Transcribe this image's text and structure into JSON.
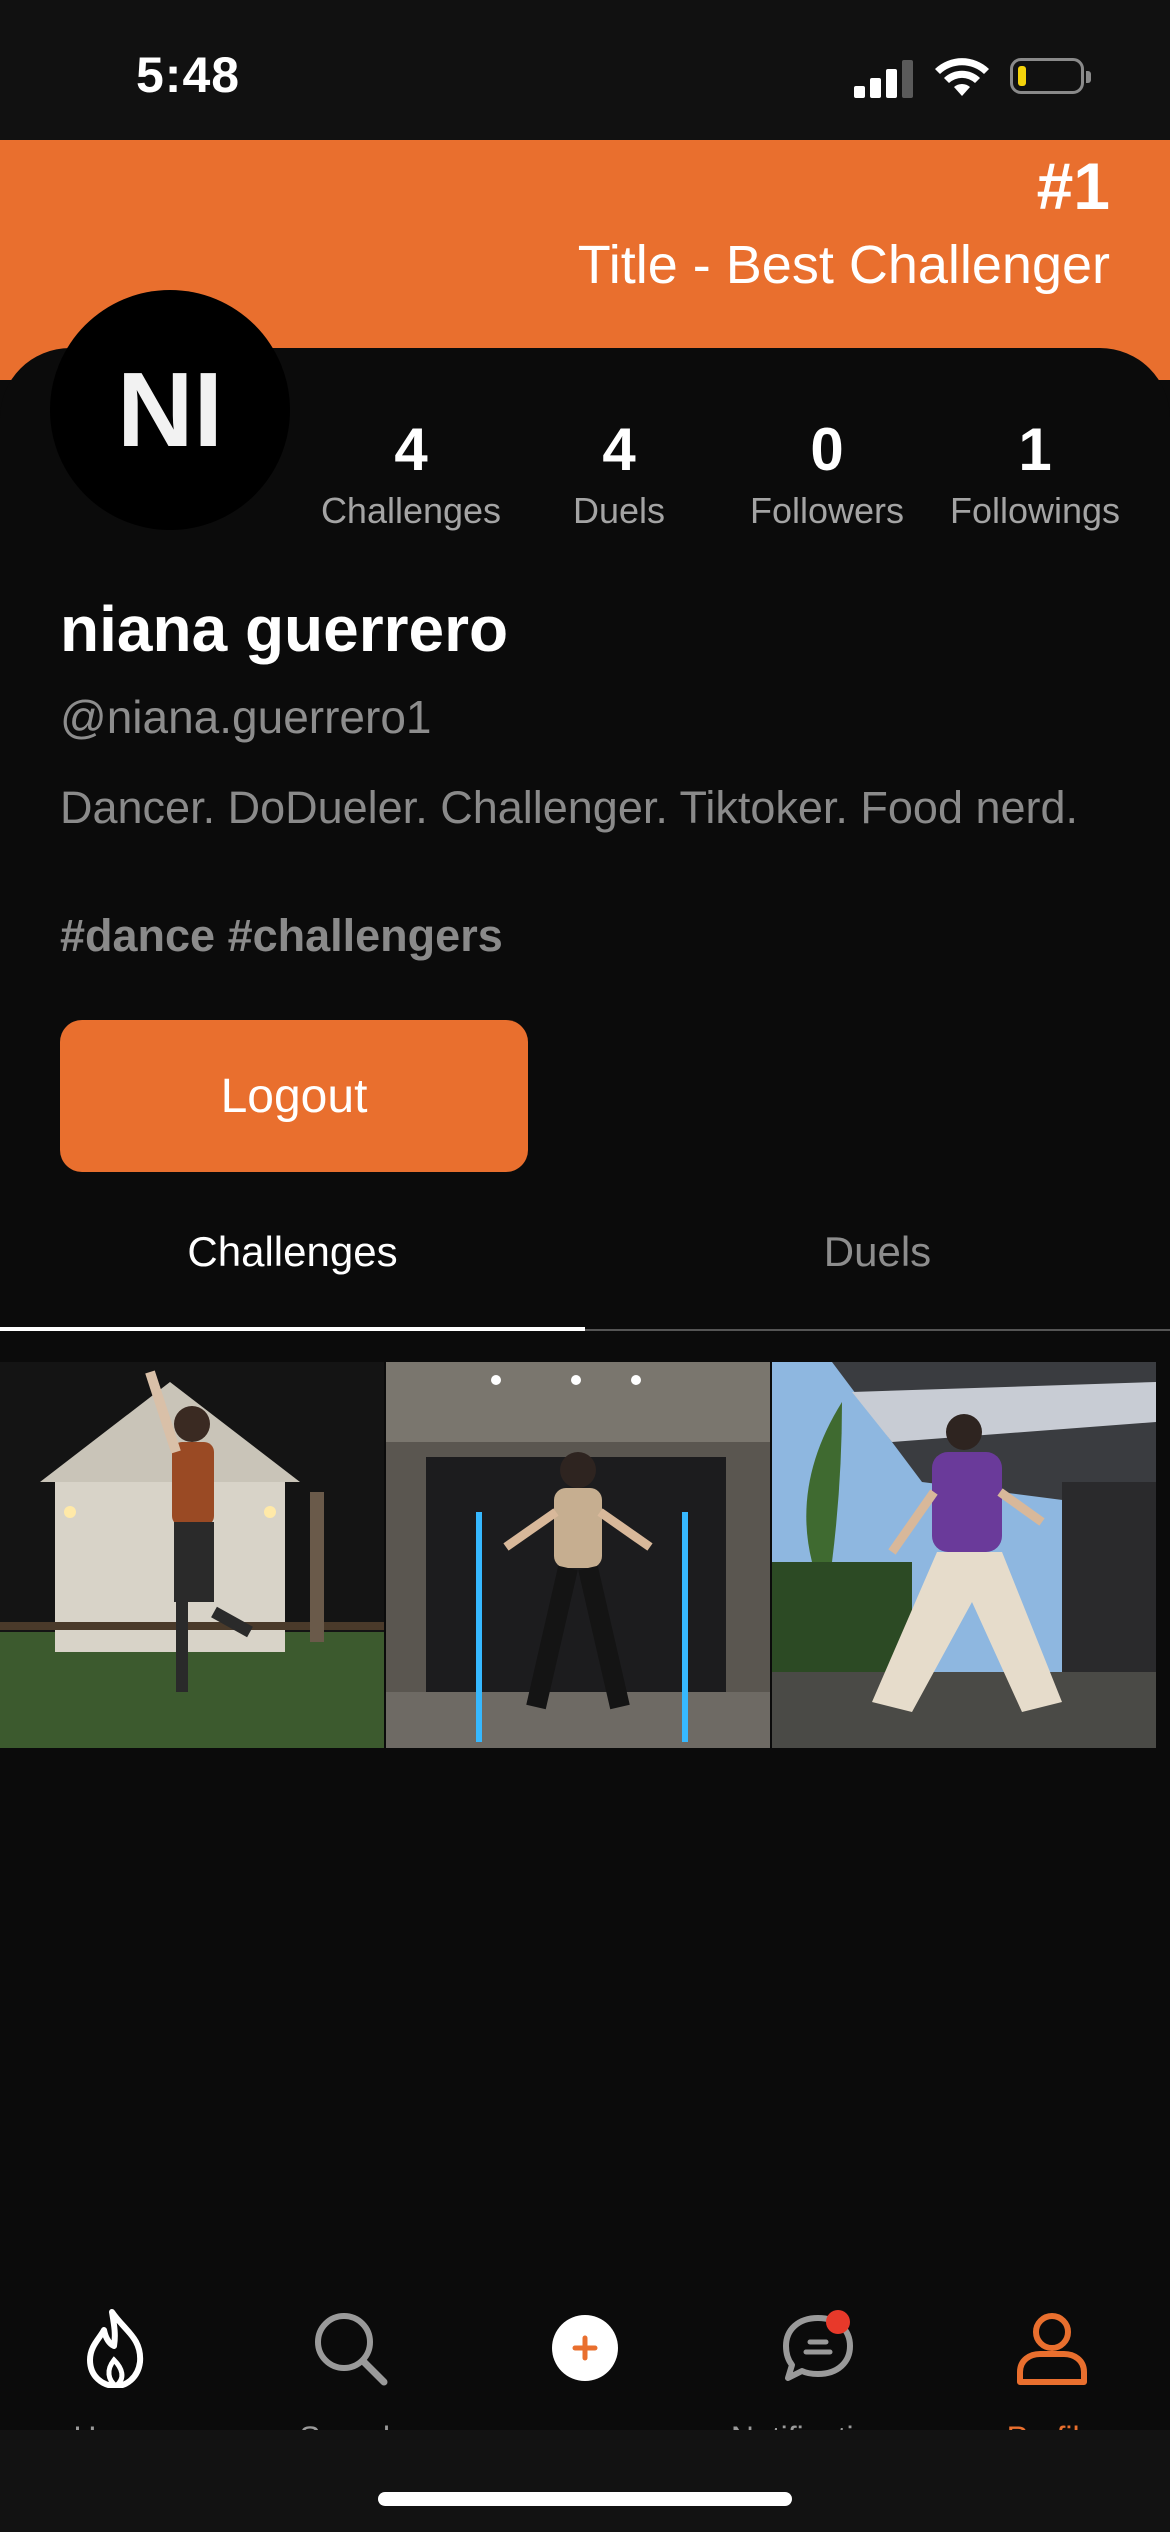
{
  "status_bar": {
    "time": "5:48"
  },
  "banner": {
    "rank": "#1",
    "title": "Title - Best Challenger"
  },
  "profile": {
    "avatar_initials": "NI",
    "name": "niana guerrero",
    "handle": "@niana.guerrero1",
    "bio": "Dancer. DoDueler. Challenger. Tiktoker. Food nerd.",
    "hashtags": "#dance #challengers",
    "stats": [
      {
        "value": "4",
        "label": "Challenges"
      },
      {
        "value": "4",
        "label": "Duels"
      },
      {
        "value": "0",
        "label": "Followers"
      },
      {
        "value": "1",
        "label": "Followings"
      }
    ],
    "logout_label": "Logout"
  },
  "tabs": [
    {
      "label": "Challenges",
      "active": true
    },
    {
      "label": "Duels",
      "active": false
    }
  ],
  "bottom_nav": [
    {
      "label": "Home",
      "icon": "flame-icon"
    },
    {
      "label": "Search",
      "icon": "search-icon"
    },
    {
      "label": "",
      "icon": "plus-icon"
    },
    {
      "label": "Notifications",
      "icon": "chat-bubble-icon"
    },
    {
      "label": "Profile",
      "icon": "person-icon",
      "active": true
    }
  ],
  "colors": {
    "accent": "#e96f2e",
    "background": "#0b0b0b",
    "notification_dot": "#e8392a"
  }
}
